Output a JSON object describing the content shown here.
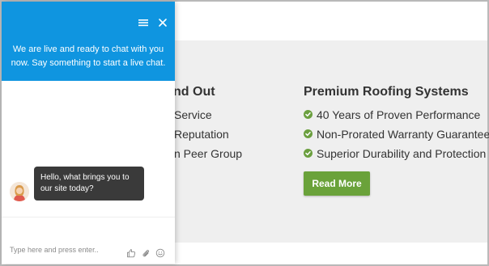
{
  "page": {
    "left_heading": "nd Out",
    "left_items": [
      "Service",
      "Reputation",
      "n Peer Group"
    ],
    "right_heading": "Premium Roofing Systems",
    "right_items": [
      "40 Years of Proven Performance",
      "Non-Prorated Warranty Guarantees",
      "Superior Durability and Protection"
    ],
    "read_more_label": "Read More"
  },
  "chat": {
    "header_message": "We are live and ready to chat with you now. Say something to start a live chat.",
    "agent_message": "Hello, what brings you to our site today?",
    "input_placeholder": "Type here and press enter..",
    "header_icons": [
      "menu-icon",
      "close-icon"
    ],
    "input_icons": [
      "thumbs-up-icon",
      "paperclip-icon",
      "smiley-icon"
    ]
  },
  "colors": {
    "chat_header": "#0f95e0",
    "check_green": "#6b9f3f",
    "button_green": "#6aa23a",
    "bubble_dark": "#3a3a3a"
  }
}
